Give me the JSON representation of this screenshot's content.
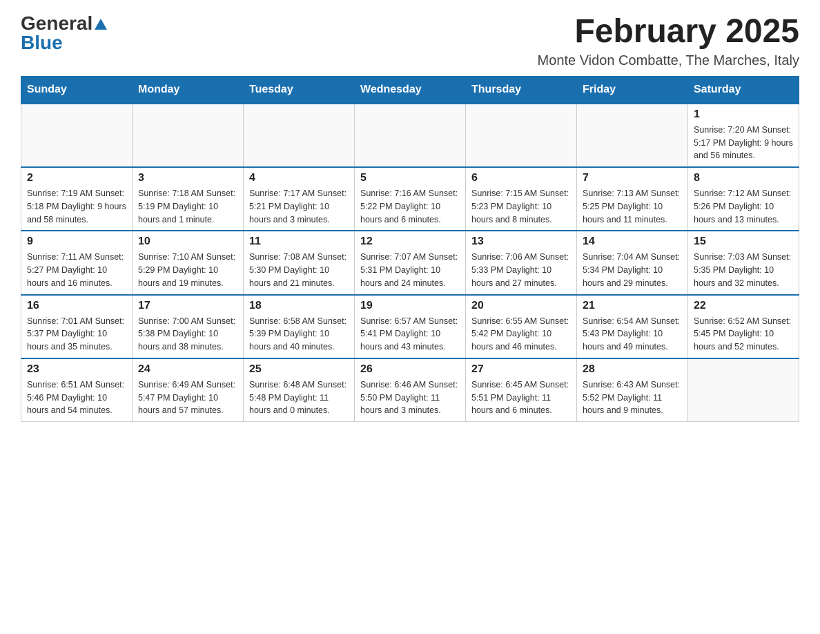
{
  "header": {
    "logo_general": "General",
    "logo_blue": "Blue",
    "title": "February 2025",
    "subtitle": "Monte Vidon Combatte, The Marches, Italy"
  },
  "days_of_week": [
    "Sunday",
    "Monday",
    "Tuesday",
    "Wednesday",
    "Thursday",
    "Friday",
    "Saturday"
  ],
  "weeks": [
    [
      {
        "day": "",
        "info": ""
      },
      {
        "day": "",
        "info": ""
      },
      {
        "day": "",
        "info": ""
      },
      {
        "day": "",
        "info": ""
      },
      {
        "day": "",
        "info": ""
      },
      {
        "day": "",
        "info": ""
      },
      {
        "day": "1",
        "info": "Sunrise: 7:20 AM\nSunset: 5:17 PM\nDaylight: 9 hours and 56 minutes."
      }
    ],
    [
      {
        "day": "2",
        "info": "Sunrise: 7:19 AM\nSunset: 5:18 PM\nDaylight: 9 hours and 58 minutes."
      },
      {
        "day": "3",
        "info": "Sunrise: 7:18 AM\nSunset: 5:19 PM\nDaylight: 10 hours and 1 minute."
      },
      {
        "day": "4",
        "info": "Sunrise: 7:17 AM\nSunset: 5:21 PM\nDaylight: 10 hours and 3 minutes."
      },
      {
        "day": "5",
        "info": "Sunrise: 7:16 AM\nSunset: 5:22 PM\nDaylight: 10 hours and 6 minutes."
      },
      {
        "day": "6",
        "info": "Sunrise: 7:15 AM\nSunset: 5:23 PM\nDaylight: 10 hours and 8 minutes."
      },
      {
        "day": "7",
        "info": "Sunrise: 7:13 AM\nSunset: 5:25 PM\nDaylight: 10 hours and 11 minutes."
      },
      {
        "day": "8",
        "info": "Sunrise: 7:12 AM\nSunset: 5:26 PM\nDaylight: 10 hours and 13 minutes."
      }
    ],
    [
      {
        "day": "9",
        "info": "Sunrise: 7:11 AM\nSunset: 5:27 PM\nDaylight: 10 hours and 16 minutes."
      },
      {
        "day": "10",
        "info": "Sunrise: 7:10 AM\nSunset: 5:29 PM\nDaylight: 10 hours and 19 minutes."
      },
      {
        "day": "11",
        "info": "Sunrise: 7:08 AM\nSunset: 5:30 PM\nDaylight: 10 hours and 21 minutes."
      },
      {
        "day": "12",
        "info": "Sunrise: 7:07 AM\nSunset: 5:31 PM\nDaylight: 10 hours and 24 minutes."
      },
      {
        "day": "13",
        "info": "Sunrise: 7:06 AM\nSunset: 5:33 PM\nDaylight: 10 hours and 27 minutes."
      },
      {
        "day": "14",
        "info": "Sunrise: 7:04 AM\nSunset: 5:34 PM\nDaylight: 10 hours and 29 minutes."
      },
      {
        "day": "15",
        "info": "Sunrise: 7:03 AM\nSunset: 5:35 PM\nDaylight: 10 hours and 32 minutes."
      }
    ],
    [
      {
        "day": "16",
        "info": "Sunrise: 7:01 AM\nSunset: 5:37 PM\nDaylight: 10 hours and 35 minutes."
      },
      {
        "day": "17",
        "info": "Sunrise: 7:00 AM\nSunset: 5:38 PM\nDaylight: 10 hours and 38 minutes."
      },
      {
        "day": "18",
        "info": "Sunrise: 6:58 AM\nSunset: 5:39 PM\nDaylight: 10 hours and 40 minutes."
      },
      {
        "day": "19",
        "info": "Sunrise: 6:57 AM\nSunset: 5:41 PM\nDaylight: 10 hours and 43 minutes."
      },
      {
        "day": "20",
        "info": "Sunrise: 6:55 AM\nSunset: 5:42 PM\nDaylight: 10 hours and 46 minutes."
      },
      {
        "day": "21",
        "info": "Sunrise: 6:54 AM\nSunset: 5:43 PM\nDaylight: 10 hours and 49 minutes."
      },
      {
        "day": "22",
        "info": "Sunrise: 6:52 AM\nSunset: 5:45 PM\nDaylight: 10 hours and 52 minutes."
      }
    ],
    [
      {
        "day": "23",
        "info": "Sunrise: 6:51 AM\nSunset: 5:46 PM\nDaylight: 10 hours and 54 minutes."
      },
      {
        "day": "24",
        "info": "Sunrise: 6:49 AM\nSunset: 5:47 PM\nDaylight: 10 hours and 57 minutes."
      },
      {
        "day": "25",
        "info": "Sunrise: 6:48 AM\nSunset: 5:48 PM\nDaylight: 11 hours and 0 minutes."
      },
      {
        "day": "26",
        "info": "Sunrise: 6:46 AM\nSunset: 5:50 PM\nDaylight: 11 hours and 3 minutes."
      },
      {
        "day": "27",
        "info": "Sunrise: 6:45 AM\nSunset: 5:51 PM\nDaylight: 11 hours and 6 minutes."
      },
      {
        "day": "28",
        "info": "Sunrise: 6:43 AM\nSunset: 5:52 PM\nDaylight: 11 hours and 9 minutes."
      },
      {
        "day": "",
        "info": ""
      }
    ]
  ]
}
